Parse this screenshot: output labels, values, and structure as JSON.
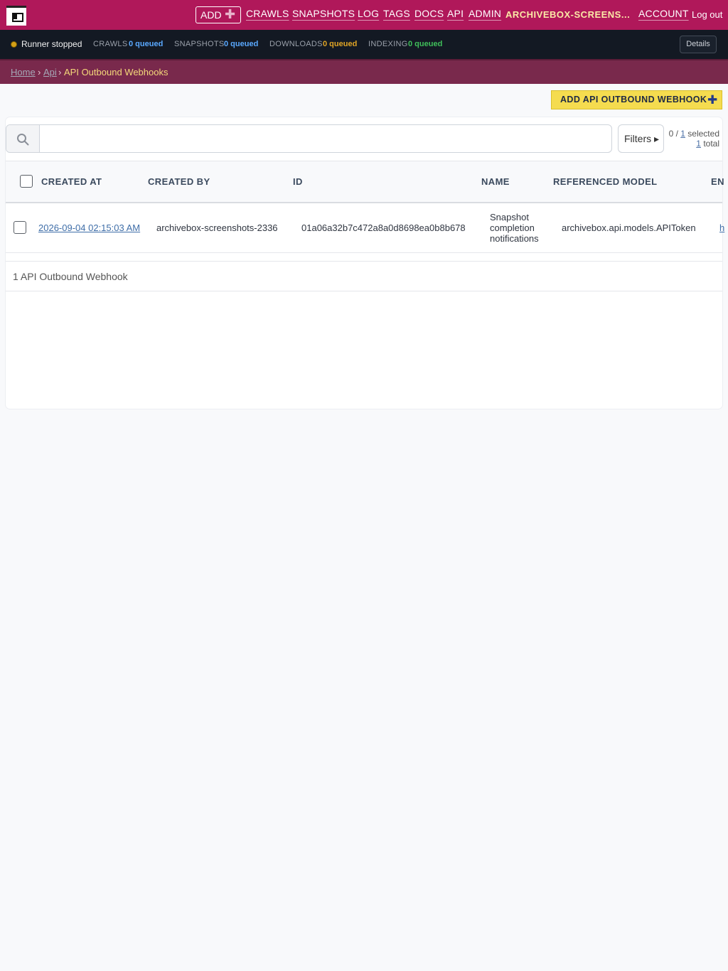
{
  "nav": {
    "add_label": "ADD",
    "links": [
      "CRAWLS",
      "SNAPSHOTS",
      "LOG",
      "TAGS",
      "DOCS",
      "API",
      "ADMIN"
    ],
    "user": "ARCHIVEBOX-SCREENS...",
    "account": "ACCOUNT",
    "logout": "Log out"
  },
  "status": {
    "runner": "Runner stopped",
    "queues": [
      {
        "label": "CRAWLS",
        "value": "0 queued",
        "color": "#5aa9ff"
      },
      {
        "label": "SNAPSHOTS",
        "value": "0 queued",
        "color": "#5aa9ff"
      },
      {
        "label": "DOWNLOADS",
        "value": "0 queued",
        "color": "#e0a526"
      },
      {
        "label": "INDEXING",
        "value": "0 queued",
        "color": "#3fbf5a"
      }
    ],
    "details": "Details"
  },
  "breadcrumb": {
    "home": "Home",
    "sep": "›",
    "api": "Api",
    "current": "API Outbound Webhooks"
  },
  "actions": {
    "add_label": "ADD API OUTBOUND WEBHOOK"
  },
  "search": {
    "value": "",
    "placeholder": ""
  },
  "filters_label": "Filters ▸",
  "selection": {
    "selected": "0",
    "total_link": "1",
    "selected_suffix": "selected",
    "total": "1",
    "total_suffix": "total"
  },
  "table": {
    "columns": [
      "CREATED AT",
      "CREATED BY",
      "ID",
      "NAME",
      "REFERENCED MODEL",
      "EN"
    ],
    "rows": [
      {
        "created_at": "2026-09-04 02:15:03 AM",
        "created_by": "archivebox-screenshots-2336",
        "id": "01a06a32b7c472a8a0d8698ea0b8b678",
        "name": "Snapshot completion notifications",
        "referenced_model": "archivebox.api.models.APIToken",
        "endpoint": "h"
      }
    ]
  },
  "footer": "1 API Outbound Webhook",
  "colors": {
    "nav_bg": "#b0185a",
    "status_bg": "#131923",
    "breadcrumb_bg": "#79294c",
    "accent_button": "#f5dc4f"
  }
}
